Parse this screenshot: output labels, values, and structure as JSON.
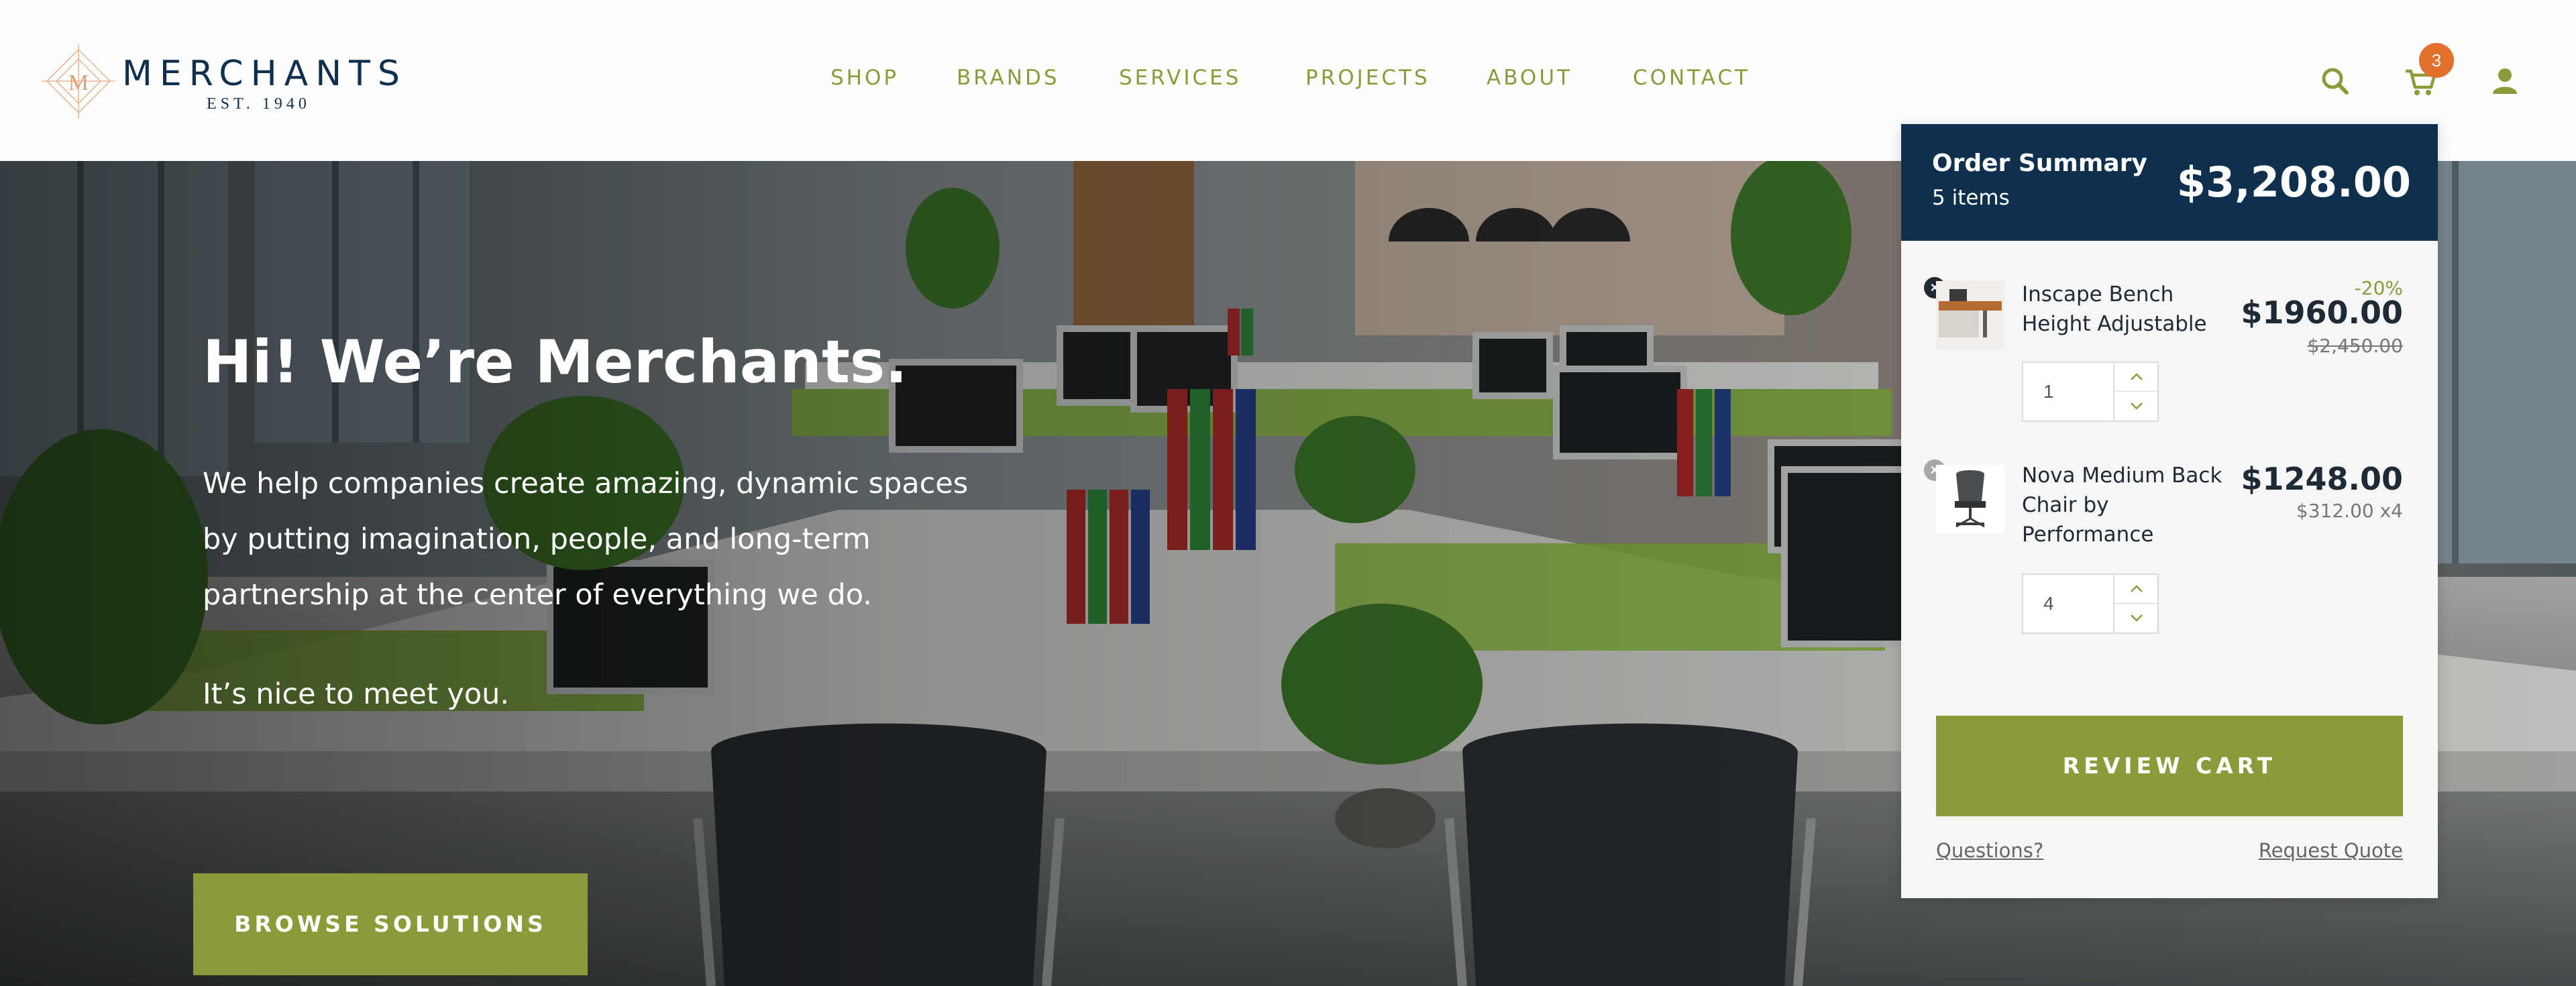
{
  "brand": {
    "name": "MERCHANTS",
    "established": "EST. 1940",
    "monogram": "M",
    "icon": "merchants-logo-mark",
    "primary_color": "#0e2f4d",
    "accent_color": "#8c9b3a",
    "badge_color": "#e26f2b"
  },
  "nav": {
    "items": [
      {
        "label": "SHOP"
      },
      {
        "label": "BRANDS"
      },
      {
        "label": "SERVICES"
      },
      {
        "label": "PROJECTS"
      },
      {
        "label": "ABOUT"
      },
      {
        "label": "CONTACT"
      }
    ]
  },
  "header_icons": {
    "search": "search-icon",
    "cart": "cart-icon",
    "account": "user-icon",
    "cart_count": "3"
  },
  "hero": {
    "title": "Hi! We’re Merchants.",
    "paragraph_lines": [
      "We help companies create amazing, dynamic spaces",
      "by putting imagination, people, and long-term",
      "partnership at the center of everything we do."
    ],
    "greeting": "It’s nice to meet you.",
    "cta_label": "BROWSE SOLUTIONS"
  },
  "order_summary": {
    "title": "Order Summary",
    "item_count_label": "5 items",
    "total": "$3,208.00",
    "items": [
      {
        "name_lines": [
          "Inscape Bench",
          "Height Adjustable"
        ],
        "quantity": "1",
        "discount_label": "-20%",
        "price": "$1960.00",
        "original_price": "$2,450.00",
        "thumb_icon": "bench-desk-thumbnail"
      },
      {
        "name_lines": [
          "Nova Medium Back",
          "Chair by",
          "Performance"
        ],
        "quantity": "4",
        "price": "$1248.00",
        "unit_price_label": "$312.00 x4",
        "thumb_icon": "office-chair-thumbnail"
      }
    ],
    "review_label": "REVIEW CART",
    "questions_label": "Questions?",
    "quote_label": "Request Quote"
  }
}
